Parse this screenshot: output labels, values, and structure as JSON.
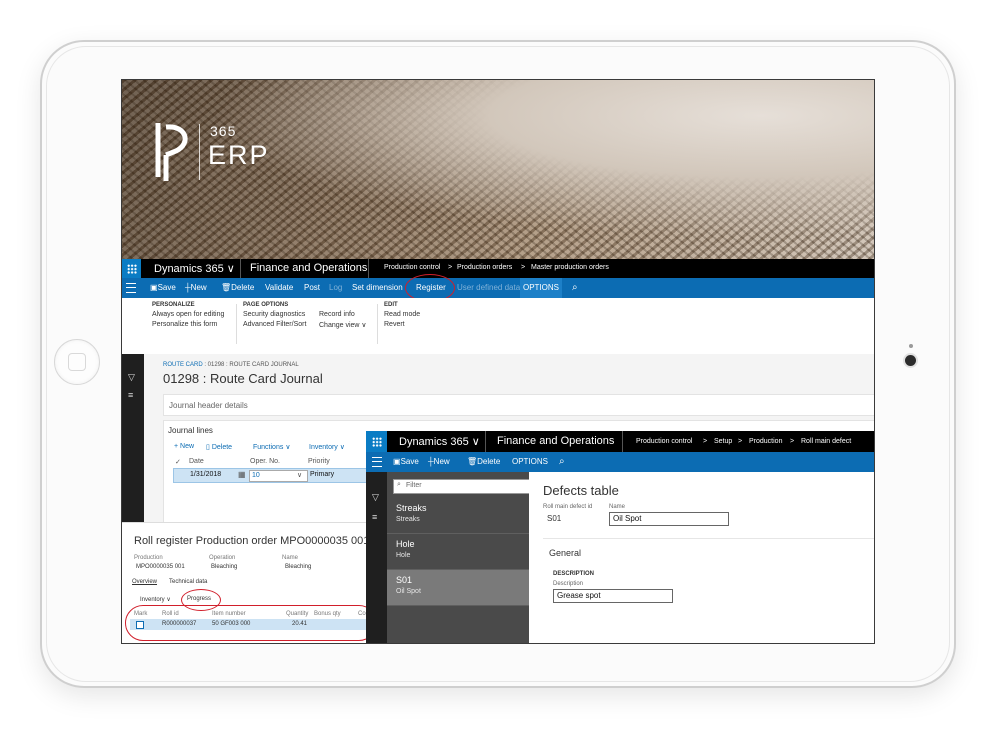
{
  "banner": {
    "logo_top": "365",
    "logo_bottom": "ERP"
  },
  "main_window": {
    "topbar": {
      "app": "Dynamics 365",
      "module": "Finance and Operations",
      "breadcrumb": [
        "Production control",
        "Production orders",
        "Master production orders"
      ]
    },
    "actions": [
      "Save",
      "New",
      "Delete",
      "Validate",
      "Post",
      "Log",
      "Set dimension",
      "Register",
      "User defined data",
      "OPTIONS"
    ],
    "ribbon": {
      "personalize": {
        "heading": "PERSONALIZE",
        "items": [
          "Always open for editing",
          "Personalize this form"
        ]
      },
      "page_options": {
        "heading": "PAGE OPTIONS",
        "items": [
          "Security diagnostics",
          "Advanced Filter/Sort",
          "Record info",
          "Change view"
        ]
      },
      "edit": {
        "heading": "EDIT",
        "items": [
          "Read mode",
          "Revert"
        ]
      }
    },
    "route_card": {
      "breadcrumb_link": "ROUTE CARD",
      "breadcrumb_rest": ": 01298 : ROUTE CARD JOURNAL",
      "title": "01298 : Route Card Journal",
      "header_section": "Journal header details",
      "lines_section": "Journal lines",
      "line_actions": [
        "New",
        "Delete",
        "Functions",
        "Inventory"
      ],
      "columns": [
        "Date",
        "Oper. No.",
        "Priority"
      ],
      "row": {
        "date": "1/31/2018",
        "oper_no": "10",
        "priority": "Primary"
      }
    }
  },
  "roll_register": {
    "title": "Roll register Production order MPO0000035 001, O",
    "fields": [
      {
        "label": "Production",
        "value": "MPO0000035 001"
      },
      {
        "label": "Operation",
        "value": "Bleaching"
      },
      {
        "label": "Name",
        "value": "Bleaching"
      }
    ],
    "tabs": [
      "Overview",
      "Technical data"
    ],
    "actions": [
      "Inventory",
      "Progress"
    ],
    "columns": [
      "Mark",
      "Roll id",
      "Item number",
      "Quantity",
      "Bonus qty",
      "Co"
    ],
    "row": {
      "roll_id": "R000000037",
      "item": "50 GF003  000",
      "quantity": "20.41"
    }
  },
  "defects_window": {
    "topbar": {
      "app": "Dynamics 365",
      "module": "Finance and Operations",
      "breadcrumb": [
        "Production control",
        "Setup",
        "Production",
        "Roll main defect"
      ]
    },
    "actions": [
      "Save",
      "New",
      "Delete",
      "OPTIONS"
    ],
    "filter_placeholder": "Filter",
    "list": [
      {
        "id": "Streaks",
        "name": "Streaks"
      },
      {
        "id": "Hole",
        "name": "Hole"
      },
      {
        "id": "S01",
        "name": "Oil Spot"
      }
    ],
    "title": "Defects table",
    "id_label": "Roll main defect id",
    "id_value": "S01",
    "name_label": "Name",
    "name_value": "Oil Spot",
    "general": "General",
    "description_heading": "DESCRIPTION",
    "description_label": "Description",
    "description_value": "Grease spot"
  },
  "colors": {
    "accent": "#0c6cb3",
    "highlight_oval": "#d11f2b",
    "dark_bar": "#000000"
  }
}
